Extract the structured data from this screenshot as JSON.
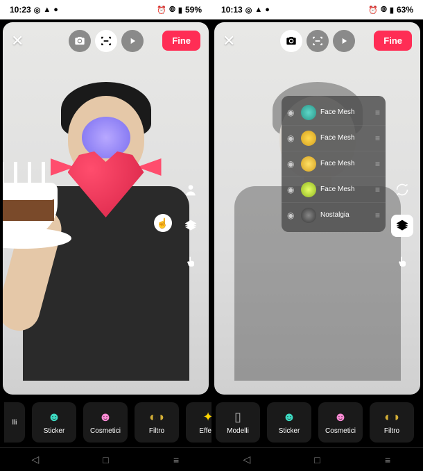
{
  "left": {
    "status": {
      "time": "10:23",
      "battery": "59%"
    },
    "toolbar": {
      "fine": "Fine"
    },
    "tabs": [
      {
        "label": "lli",
        "icon": "model",
        "partial": true
      },
      {
        "label": "Sticker",
        "icon": "sticker"
      },
      {
        "label": "Cosmetici",
        "icon": "cosmetic"
      },
      {
        "label": "Filtro",
        "icon": "filter"
      },
      {
        "label": "Effetti",
        "icon": "effect"
      }
    ]
  },
  "right": {
    "status": {
      "time": "10:13",
      "battery": "63%"
    },
    "toolbar": {
      "fine": "Fine"
    },
    "layers": [
      {
        "label": "Face Mesh",
        "thumb": "thumb1"
      },
      {
        "label": "Face Mesh",
        "thumb": "thumb2"
      },
      {
        "label": "Face Mesh",
        "thumb": "thumb3"
      },
      {
        "label": "Face Mesh",
        "thumb": "thumb4"
      },
      {
        "label": "Nostalgia",
        "thumb": "thumb5"
      }
    ],
    "tabs": [
      {
        "label": "Modelli",
        "icon": "model"
      },
      {
        "label": "Sticker",
        "icon": "sticker"
      },
      {
        "label": "Cosmetici",
        "icon": "cosmetic"
      },
      {
        "label": "Filtro",
        "icon": "filter"
      }
    ]
  }
}
